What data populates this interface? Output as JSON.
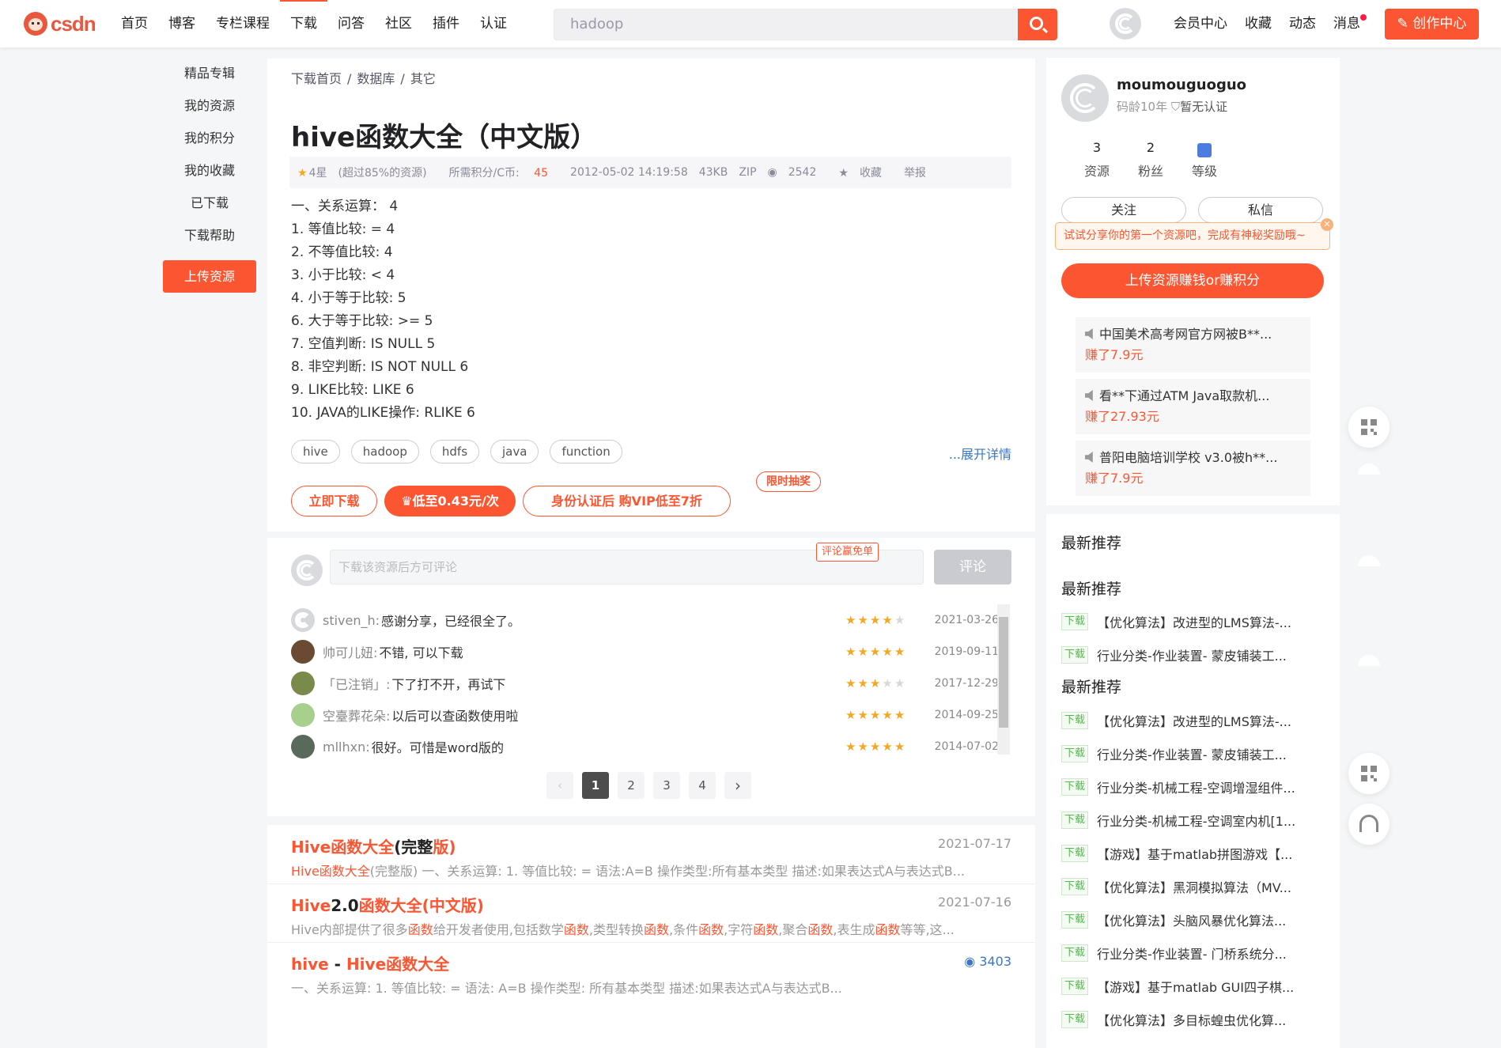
{
  "header": {
    "logo_text": "csdn",
    "nav": [
      "首页",
      "博客",
      "专栏课程",
      "下载",
      "问答",
      "社区",
      "插件",
      "认证"
    ],
    "active_nav": "下载",
    "search_value": "hadoop",
    "links": [
      "会员中心",
      "收藏",
      "动态",
      "消息"
    ],
    "create_label": "创作中心"
  },
  "leftnav": {
    "items": [
      "精品专辑",
      "我的资源",
      "我的积分",
      "我的收藏",
      "已下载",
      "下载帮助"
    ],
    "upload_label": "上传资源"
  },
  "resource": {
    "breadcrumb": [
      "下载首页",
      "数据库",
      "其它"
    ],
    "title": "hive函数大全（中文版）",
    "rating": "4星",
    "rating_note": "(超过85%的资源)",
    "points_label": "所需积分/C币:",
    "points": "45",
    "datetime": "2012-05-02 14:19:58",
    "size": "43KB",
    "format": "ZIP",
    "views": "2542",
    "collect": "收藏",
    "report": "举报",
    "description": [
      "一、关系运算： 4",
      "1. 等值比较: = 4",
      "2. 不等值比较: 4",
      "3. 小于比较: < 4",
      "4. 小于等于比较: 5",
      "6. 大于等于比较: >= 5",
      "7. 空值判断: IS NULL 5",
      "8. 非空判断: IS NOT NULL 6",
      "9. LIKE比较: LIKE 6",
      "10. JAVA的LIKE操作: RLIKE 6"
    ],
    "tags": [
      "hive",
      "hadoop",
      "hdfs",
      "java",
      "function"
    ],
    "expand_label": "...展开详情",
    "download_label": "立即下载",
    "vip_price_label": "低至0.43元/次",
    "lottery_label": "限时抽奖",
    "vip_label": "身份认证后 购VIP低至7折"
  },
  "comments": {
    "placeholder": "下载该资源后方可评论",
    "badge": "评论赢免单",
    "submit_label": "评论",
    "list": [
      {
        "name": "stiven_h:",
        "text": "感谢分享，已经很全了。",
        "stars": 4,
        "date": "2021-03-26"
      },
      {
        "name": "帅可儿妞:",
        "text": "不错, 可以下载",
        "stars": 5,
        "date": "2019-09-11"
      },
      {
        "name": "「已注销」:",
        "text": "下了打不开，再试下",
        "stars": 3,
        "date": "2017-12-29"
      },
      {
        "name": "空臺葬花朵:",
        "text": "以后可以查函数使用啦",
        "stars": 5,
        "date": "2014-09-25"
      },
      {
        "name": "mllhxn:",
        "text": "很好。可惜是word版的",
        "stars": 5,
        "date": "2014-07-02"
      }
    ],
    "pages": [
      "1",
      "2",
      "3",
      "4"
    ],
    "current_page": "1"
  },
  "related": [
    {
      "title_parts": [
        [
          "Hive函数大全",
          true
        ],
        [
          "(完整",
          false
        ],
        [
          "版)",
          true
        ]
      ],
      "desc": "Hive函数大全(完整版) 一、关系运算: 1. 等值比较: = 语法:A=B 操作类型:所有基本类型 描述:如果表达式A与表达式B...",
      "date": "2021-07-17"
    },
    {
      "title_parts": [
        [
          "Hive",
          true
        ],
        [
          "2.0",
          false
        ],
        [
          "函数大全(中文版)",
          true
        ]
      ],
      "desc": "Hive内部提供了很多函数给开发者使用,包括数学函数,类型转换函数,条件函数,字符函数,聚合函数,表生成函数等等,这...",
      "date": "2021-07-16"
    },
    {
      "title_parts": [
        [
          "hive",
          true
        ],
        [
          " - ",
          false
        ],
        [
          "Hive函数大全",
          true
        ]
      ],
      "desc": "一、关系运算:  1. 等值比较: =        语法:  A=B        操作类型:  所有基本类型        描述:如果表达式A与表达式B...",
      "views": "3403"
    }
  ],
  "profile": {
    "name": "moumouguoguo",
    "age": "码龄10年",
    "cert": "暂无认证",
    "stats": [
      {
        "n": "3",
        "l": "资源"
      },
      {
        "n": "2",
        "l": "粉丝"
      },
      {
        "n": "",
        "l": "等级"
      }
    ],
    "follow_label": "关注",
    "message_label": "私信",
    "tip": "试试分享你的第一个资源吧，完成有神秘奖励哦~",
    "upload_label": "上传资源赚钱or赚积分",
    "earnings": [
      {
        "title": "中国美术高考网官方网被B**...",
        "amount": "赚了7.9元"
      },
      {
        "title": "看**下通过ATM Java取款机...",
        "amount": "赚了27.93元"
      },
      {
        "title": "普阳电脑培训学校 v3.0被h**...",
        "amount": "赚了7.9元"
      }
    ]
  },
  "recommend": {
    "heading": "最新推荐",
    "badge": "下载",
    "group1": [
      "【优化算法】改进型的LMS算法-...",
      "行业分类-作业装置- 蒙皮铺装工..."
    ],
    "group2": [
      "【优化算法】改进型的LMS算法-...",
      "行业分类-作业装置- 蒙皮铺装工...",
      "行业分类-机械工程-空调增湿组件...",
      "行业分类-机械工程-空调室内机[1...",
      "【游戏】基于matlab拼图游戏【...",
      "【优化算法】黑洞模拟算法（MV...",
      "【优化算法】头脑风暴优化算法...",
      "行业分类-作业装置- 门桥系统分...",
      "【游戏】基于matlab GUI四子棋...",
      "【优化算法】多目标蝗虫优化算..."
    ]
  },
  "colors": {
    "accent": "#fc5531",
    "link": "#3a77c5",
    "star": "#f5a623"
  }
}
